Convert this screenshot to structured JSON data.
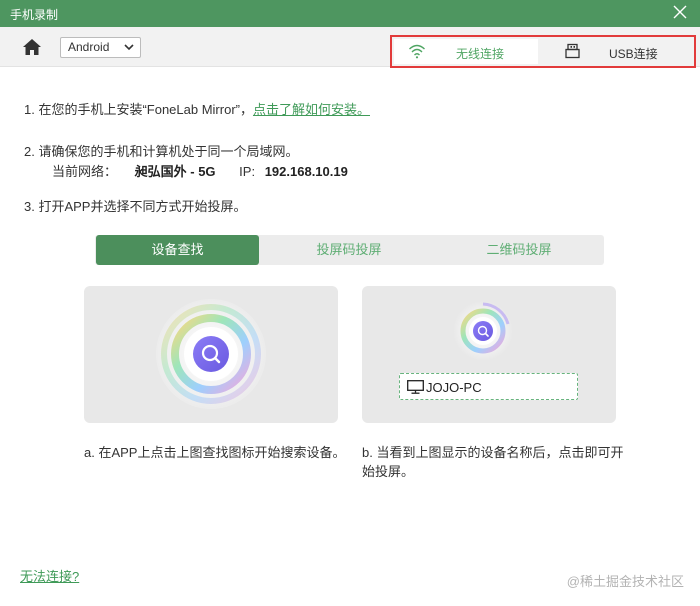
{
  "window": {
    "title": "手机录制"
  },
  "toolbar": {
    "os_selected": "Android"
  },
  "connection": {
    "wireless_label": "无线连接",
    "usb_label": "USB连接",
    "active": "wireless"
  },
  "steps": {
    "step1_text": "1. 在您的手机上安装“FoneLab Mirror”，",
    "step1_link": "点击了解如何安装。",
    "step2_text": "2. 请确保您的手机和计算机处于同一个局域网。",
    "network_label": "当前网络：",
    "network_name": "昶弘国外 - 5G",
    "ip_label": "IP:",
    "ip_value": "192.168.10.19",
    "step3_text": "3. 打开APP并选择不同方式开始投屏。"
  },
  "mode_tabs": [
    {
      "label": "设备查找",
      "active": true
    },
    {
      "label": "投屏码投屏",
      "active": false
    },
    {
      "label": "二维码投屏",
      "active": false
    }
  ],
  "device": {
    "name": "JOJO-PC"
  },
  "captions": {
    "a": "a. 在APP上点击上图查找图标开始搜索设备。",
    "b": "b. 当看到上图显示的设备名称后，点击即可开始投屏。"
  },
  "footer": {
    "help_link": "无法连接?",
    "watermark": "@稀土掘金技术社区"
  },
  "colors": {
    "title_bar": "#4e9660",
    "accent_green": "#4fa563",
    "active_tab": "#4c8f5c",
    "highlight_border": "#e23b3b"
  }
}
